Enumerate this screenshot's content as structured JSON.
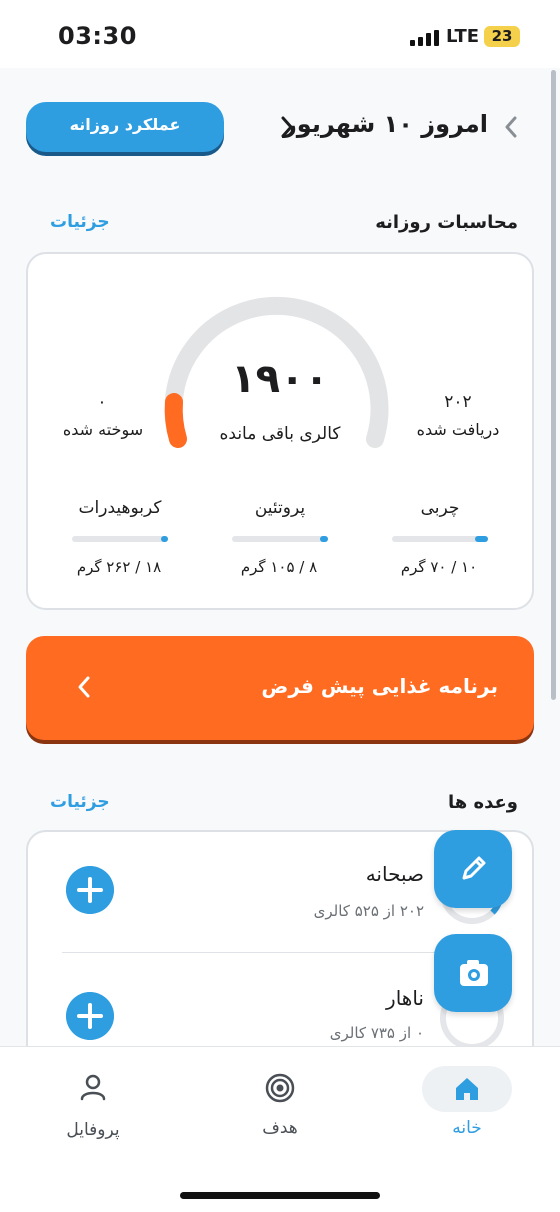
{
  "status_bar": {
    "time": "03:30",
    "network": "LTE",
    "battery": "23"
  },
  "header": {
    "date_title": "امروز ۱۰ شهریور",
    "daily_performance_button": "عملکرد روزانه"
  },
  "daily_calc": {
    "section_title": "محاسبات روزانه",
    "details_link": "جزئیات",
    "remaining_value": "۱۹۰۰",
    "remaining_label": "کالری باقی مانده",
    "burned_value": "۰",
    "burned_label": "سوخته شده",
    "received_value": "۲۰۲",
    "received_label": "دریافت شده",
    "macros": [
      {
        "name": "کربوهیدرات",
        "amount": "۱۸ / ۲۶۲ گرم",
        "progress": 0.07
      },
      {
        "name": "پروتئین",
        "amount": "۸ / ۱۰۵ گرم",
        "progress": 0.08
      },
      {
        "name": "چربی",
        "amount": "۱۰ / ۷۰ گرم",
        "progress": 0.14
      }
    ]
  },
  "plan_banner": {
    "label": "برنامه غذایی پیش فرض"
  },
  "meals": {
    "section_title": "وعده ها",
    "details_link": "جزئیات",
    "items": [
      {
        "name": "صبحانه",
        "calories": "۲۰۲ از ۵۲۵ کالری"
      },
      {
        "name": "ناهار",
        "calories": "۰ از ۷۳۵ کالری"
      }
    ]
  },
  "bottom_nav": {
    "home": "خانه",
    "goal": "هدف",
    "profile": "پروفایل"
  },
  "colors": {
    "accent_blue": "#2f9ee1",
    "accent_orange": "#ff6b21"
  }
}
